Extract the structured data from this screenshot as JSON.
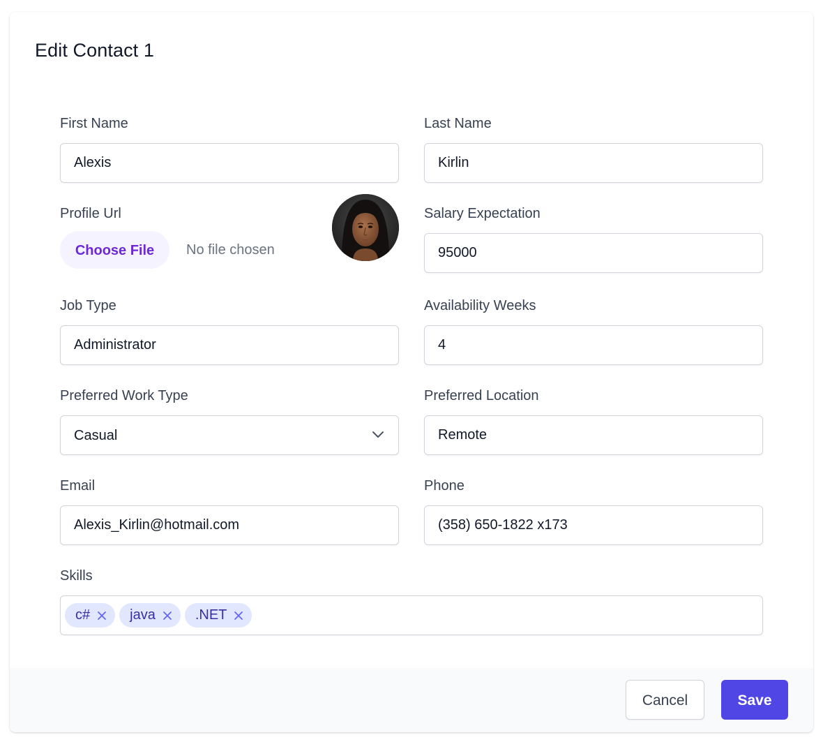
{
  "title": "Edit Contact 1",
  "fields": {
    "first_name": {
      "label": "First Name",
      "value": "Alexis"
    },
    "last_name": {
      "label": "Last Name",
      "value": "Kirlin"
    },
    "profile_url": {
      "label": "Profile Url",
      "button": "Choose File",
      "status": "No file chosen"
    },
    "salary": {
      "label": "Salary Expectation",
      "value": "95000"
    },
    "job_type": {
      "label": "Job Type",
      "value": "Administrator"
    },
    "availability": {
      "label": "Availability Weeks",
      "value": "4"
    },
    "work_type": {
      "label": "Preferred Work Type",
      "value": "Casual"
    },
    "location": {
      "label": "Preferred Location",
      "value": "Remote"
    },
    "email": {
      "label": "Email",
      "value": "Alexis_Kirlin@hotmail.com"
    },
    "phone": {
      "label": "Phone",
      "value": "(358) 650-1822 x173"
    },
    "skills": {
      "label": "Skills",
      "tags": [
        "c#",
        "java",
        ".NET"
      ]
    }
  },
  "footer": {
    "cancel": "Cancel",
    "save": "Save"
  },
  "icons": {
    "dropdown": "chevron-down-icon",
    "remove_tag": "close-icon",
    "avatar": "profile-photo"
  },
  "colors": {
    "accent": "#4f46e5",
    "file_button_bg": "#f5f3ff",
    "file_button_text": "#6d28d9",
    "chip_bg": "#e0e7ff",
    "chip_text": "#3730a3"
  }
}
